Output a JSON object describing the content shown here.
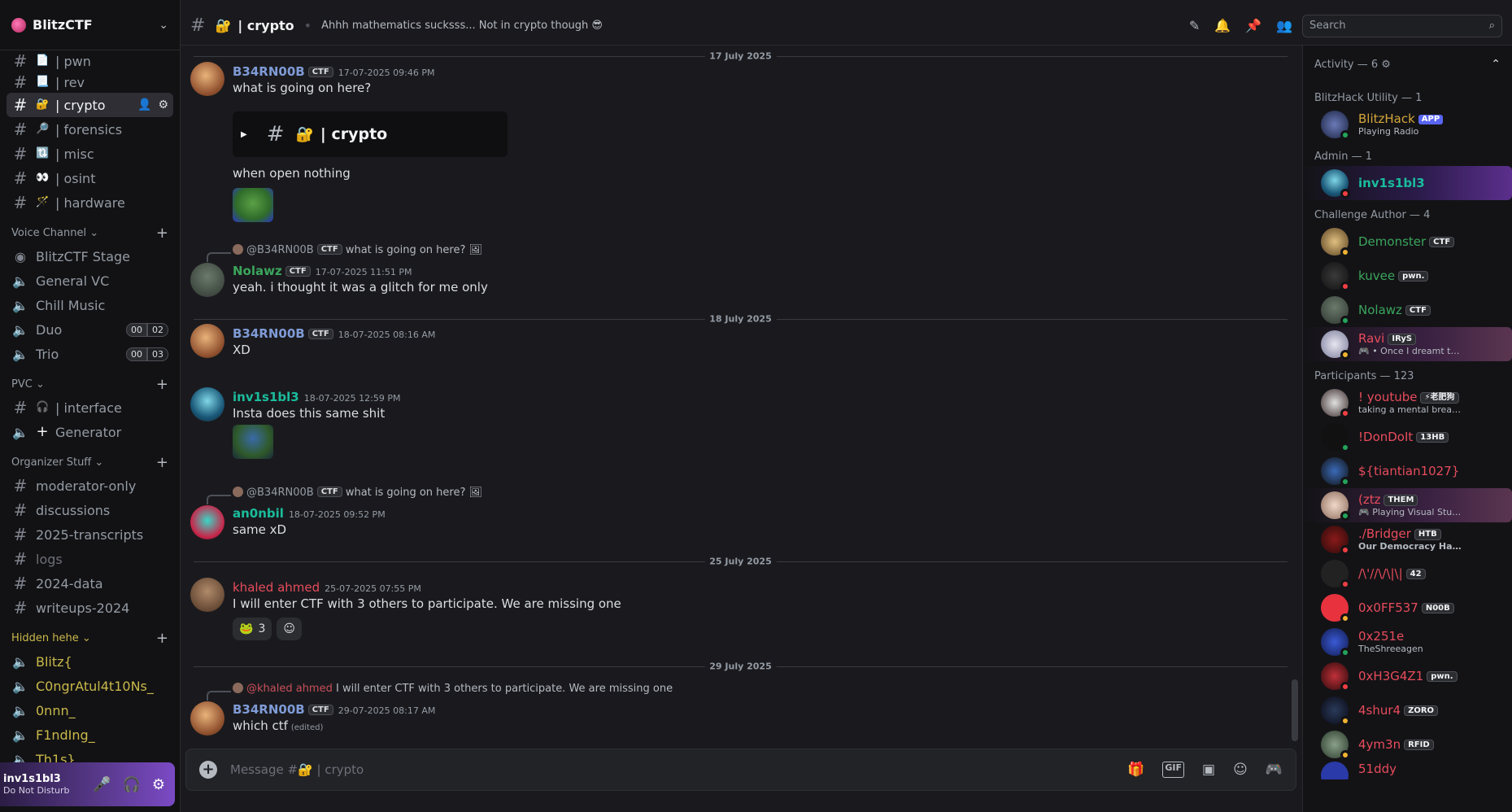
{
  "server": {
    "name": "BlitzCTF"
  },
  "channels": [
    {
      "name": "| pwn",
      "emoji": "📄"
    },
    {
      "name": "| rev",
      "emoji": "📃"
    },
    {
      "name": "| crypto",
      "emoji": "🔐",
      "active": true
    },
    {
      "name": "| forensics",
      "emoji": "🔎"
    },
    {
      "name": "| misc",
      "emoji": "🔃"
    },
    {
      "name": "| osint",
      "emoji": "👀"
    },
    {
      "name": "| hardware",
      "emoji": "🪄"
    }
  ],
  "voice_category": {
    "label": "Voice Channel"
  },
  "voice": [
    {
      "name": "BlitzCTF Stage",
      "icon": "stage"
    },
    {
      "name": "General VC",
      "icon": "speaker"
    },
    {
      "name": "Chill Music",
      "icon": "speaker"
    },
    {
      "name": "Duo",
      "icon": "speaker",
      "badge_a": "00",
      "badge_b": "02"
    },
    {
      "name": "Trio",
      "icon": "speaker",
      "badge_a": "00",
      "badge_b": "03"
    }
  ],
  "pvc_category": {
    "label": "PVC"
  },
  "pvc": [
    {
      "name": "| interface",
      "emoji": "🎧",
      "icon": "hash"
    },
    {
      "name": "Generator",
      "emoji": "+",
      "icon": "speaker"
    }
  ],
  "org_category": {
    "label": "Organizer Stuff"
  },
  "org": [
    {
      "name": "moderator-only"
    },
    {
      "name": "discussions"
    },
    {
      "name": "2025-transcripts"
    },
    {
      "name": "logs"
    },
    {
      "name": "2024-data"
    },
    {
      "name": "writeups-2024"
    }
  ],
  "hidden_category": {
    "label": "Hidden hehe"
  },
  "hidden": [
    {
      "name": "Blitz{"
    },
    {
      "name": "C0ngrAtul4t10Ns_"
    },
    {
      "name": "0nnn_"
    },
    {
      "name": "F1ndIng_"
    },
    {
      "name": "Th1s}"
    }
  ],
  "user": {
    "name": "inv1s1bl3",
    "status": "Do Not Disturb"
  },
  "topbar": {
    "channel": "| crypto",
    "topic": "Ahhh mathematics sucksss... Not in crypto though 😎",
    "search_placeholder": "Search"
  },
  "messages": {
    "d1": "17 July 2025",
    "m1": {
      "author": "B34RN00B",
      "tag": "CTF",
      "time": "17-07-2025 09:46 PM",
      "text": "what is going on here?",
      "embed": "| crypto",
      "text2": "when open nothing"
    },
    "r2": {
      "to": "@B34RN00B",
      "tag": "CTF",
      "text": "what is going on here?"
    },
    "m2": {
      "author": "Nolawz",
      "tag": "CTF",
      "time": "17-07-2025 11:51 PM",
      "text": "yeah. i thought it was a glitch for me only"
    },
    "d2": "18 July 2025",
    "m3": {
      "author": "B34RN00B",
      "tag": "CTF",
      "time": "18-07-2025 08:16 AM",
      "text": "XD"
    },
    "m4": {
      "author": "inv1s1bl3",
      "time": "18-07-2025 12:59 PM",
      "text": "Insta does this same shit"
    },
    "r5": {
      "to": "@B34RN00B",
      "tag": "CTF",
      "text": "what is going on here?"
    },
    "m5": {
      "author": "an0nbil",
      "time": "18-07-2025 09:52 PM",
      "text": "same xD"
    },
    "d3": "25 July 2025",
    "m6": {
      "author": "khaled ahmed",
      "time": "25-07-2025 07:55 PM",
      "text": "I will enter CTF with 3 others to participate. We are missing one",
      "reaction_count": "3"
    },
    "d4": "29 July 2025",
    "r7": {
      "to": "@khaled ahmed",
      "text": "I will enter CTF with 3 others to participate. We are missing one"
    },
    "m7": {
      "author": "B34RN00B",
      "tag": "CTF",
      "time": "29-07-2025 08:17 AM",
      "text": "which ctf",
      "edited": "(edited)"
    }
  },
  "composer": {
    "placeholder": "Message #🔐 | crypto"
  },
  "members": {
    "activity": "Activity — 6",
    "sections": {
      "utility": "BlitzHack Utility — 1",
      "admin": "Admin — 1",
      "author": "Challenge Author — 4",
      "participants": "Participants — 123"
    },
    "list": {
      "blitzhack": {
        "name": "BlitzHack",
        "tag": "APP",
        "sub": "Playing Radio"
      },
      "inv": {
        "name": "inv1s1bl3"
      },
      "demonster": {
        "name": "Demonster",
        "tag": "CTF"
      },
      "kuvee": {
        "name": "kuvee",
        "tag": "pwn."
      },
      "nolawz": {
        "name": "Nolawz",
        "tag": "CTF"
      },
      "ravi": {
        "name": "Ravi",
        "tag": "IRyS",
        "sub": "🎮 • Once I dreamt that..."
      },
      "youtube": {
        "name": "! youtube",
        "tag": "⚡老肥狗",
        "sub": "taking a mental break, will b..."
      },
      "dondolt": {
        "name": "!DonDoIt",
        "tag": "13HB"
      },
      "tiantian": {
        "name": "${tiantian1027}"
      },
      "ztz": {
        "name": "(ztz",
        "tag": "THEM",
        "sub": "🎮 Playing Visual Studi..."
      },
      "bridger": {
        "name": "./Bridger",
        "tag": "HTB",
        "sub": "Our Democracy Has Been ..."
      },
      "slashes": {
        "name": "/\\'//\\/\\|\\|",
        "tag": "42"
      },
      "off537": {
        "name": "0x0FF537",
        "tag": "N00B"
      },
      "x251e": {
        "name": "0x251e",
        "sub": "TheShreeagen"
      },
      "h3g4z1": {
        "name": "0xH3G4Z1",
        "tag": "pwn."
      },
      "shur4": {
        "name": "4shur4",
        "tag": "ZORO"
      },
      "ym3n": {
        "name": "4ym3n",
        "tag": "RFID"
      },
      "last": {
        "name": "51ddy"
      }
    }
  },
  "colors": {
    "accent_green": "#3ba55c",
    "accent_teal": "#1abc9c",
    "accent_red": "#e74c5c",
    "accent_blue": "#7f9bd6"
  }
}
